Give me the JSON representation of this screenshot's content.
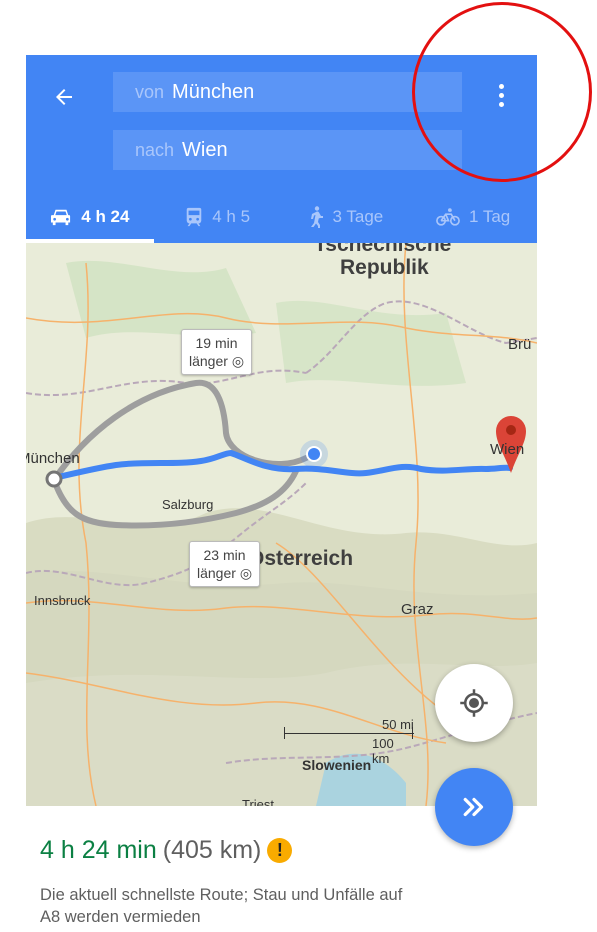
{
  "header": {
    "back_icon": "arrow-left-icon",
    "from_prefix": "von",
    "from_value": "München",
    "to_prefix": "nach",
    "to_value": "Wien",
    "menu_icon": "more-vert-icon"
  },
  "tabs": [
    {
      "icon": "car-icon",
      "label": "4 h 24",
      "active": true
    },
    {
      "icon": "train-icon",
      "label": "4 h 5",
      "active": false
    },
    {
      "icon": "walk-icon",
      "label": "3 Tage",
      "active": false
    },
    {
      "icon": "bike-icon",
      "label": "1 Tag",
      "active": false
    }
  ],
  "map": {
    "labels": {
      "tschechische": "Tschechische",
      "republik": "Republik",
      "brno": "Brü",
      "munchen": "München",
      "wien": "Wien",
      "salzburg": "Salzburg",
      "osterreich": "Österreich",
      "innsbruck": "Innsbruck",
      "graz": "Graz",
      "slowenien": "Slowenien",
      "triest": "Triest"
    },
    "callouts": {
      "alt1_time": "19 min",
      "alt1_text": "länger",
      "alt2_time": "23 min",
      "alt2_text": "länger"
    },
    "scale": {
      "miles": "50 mi",
      "km": "100 km"
    },
    "route_color": "#4285f4",
    "alt_route_color": "#9e9e9e"
  },
  "buttons": {
    "locate_icon": "my-location-icon",
    "start_icon": "double-chevron-right-icon"
  },
  "summary": {
    "duration": "4 h 24 min",
    "distance": "(405 km)",
    "warning_icon": "warning-icon",
    "warning_glyph": "!",
    "description": "Die aktuell schnellste Route; Stau und Unfälle auf A8 werden vermieden"
  },
  "annotation": {
    "color": "#e31010"
  }
}
